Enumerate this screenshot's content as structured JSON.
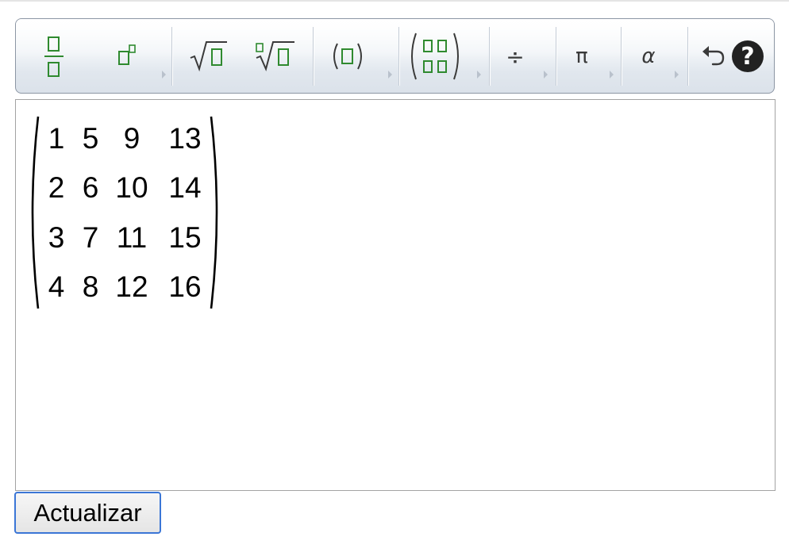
{
  "toolbar": {
    "buttons": [
      {
        "name": "fraction",
        "icon": "fraction-icon"
      },
      {
        "name": "superscript",
        "icon": "superscript-icon"
      },
      {
        "name": "square-root",
        "icon": "square-root-icon"
      },
      {
        "name": "nth-root",
        "icon": "nth-root-icon"
      },
      {
        "name": "parentheses",
        "icon": "parentheses-icon"
      },
      {
        "name": "matrix",
        "icon": "matrix-icon"
      },
      {
        "name": "operators",
        "icon": "divide-icon",
        "symbol": "÷"
      },
      {
        "name": "constants",
        "icon": "pi-icon",
        "symbol": "π"
      },
      {
        "name": "greek-letters",
        "icon": "alpha-icon",
        "symbol": "α"
      },
      {
        "name": "undo",
        "icon": "undo-icon"
      },
      {
        "name": "help",
        "icon": "help-icon",
        "symbol": "?"
      }
    ],
    "colors": {
      "icon_green": "#2f8a2f",
      "icon_dark": "#3a3a3a",
      "help_bg": "#222222"
    }
  },
  "editor": {
    "matrix": {
      "rows": [
        [
          "1",
          "5",
          "9",
          "13"
        ],
        [
          "2",
          "6",
          "10",
          "14"
        ],
        [
          "3",
          "7",
          "11",
          "15"
        ],
        [
          "4",
          "8",
          "12",
          "16"
        ]
      ]
    }
  },
  "update_button": {
    "label": "Actualizar",
    "border_color": "#3b76d6"
  }
}
